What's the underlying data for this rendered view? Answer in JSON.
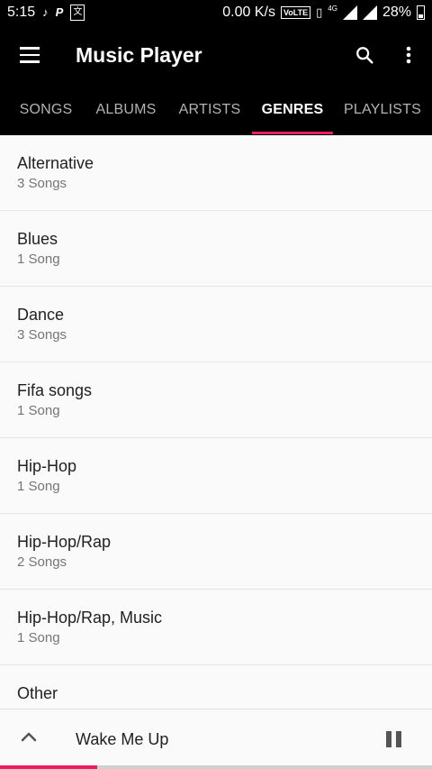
{
  "status_bar": {
    "time": "5:15",
    "net_speed": "0.00 K/s",
    "volte": "VoLTE",
    "network": "4G",
    "battery": "28%"
  },
  "app_bar": {
    "title": "Music Player"
  },
  "tabs": [
    {
      "label": "SONGS",
      "active": false
    },
    {
      "label": "ALBUMS",
      "active": false
    },
    {
      "label": "ARTISTS",
      "active": false
    },
    {
      "label": "GENRES",
      "active": true
    },
    {
      "label": "PLAYLISTS",
      "active": false
    }
  ],
  "genres": [
    {
      "name": "Alternative",
      "count": "3 Songs"
    },
    {
      "name": "Blues",
      "count": "1 Song"
    },
    {
      "name": "Dance",
      "count": "3 Songs"
    },
    {
      "name": "Fifa songs",
      "count": "1 Song"
    },
    {
      "name": "Hip-Hop",
      "count": "1 Song"
    },
    {
      "name": "Hip-Hop/Rap",
      "count": "2 Songs"
    },
    {
      "name": "Hip-Hop/Rap, Music",
      "count": "1 Song"
    },
    {
      "name": "Other",
      "count": ""
    }
  ],
  "now_playing": {
    "title": "Wake Me Up",
    "progress_fraction": 0.225
  },
  "colors": {
    "accent": "#e91e63",
    "bar_background": "#000000"
  },
  "icons": [
    "menu-icon",
    "search-icon",
    "more-vert-icon",
    "expand-up-icon",
    "pause-icon"
  ]
}
